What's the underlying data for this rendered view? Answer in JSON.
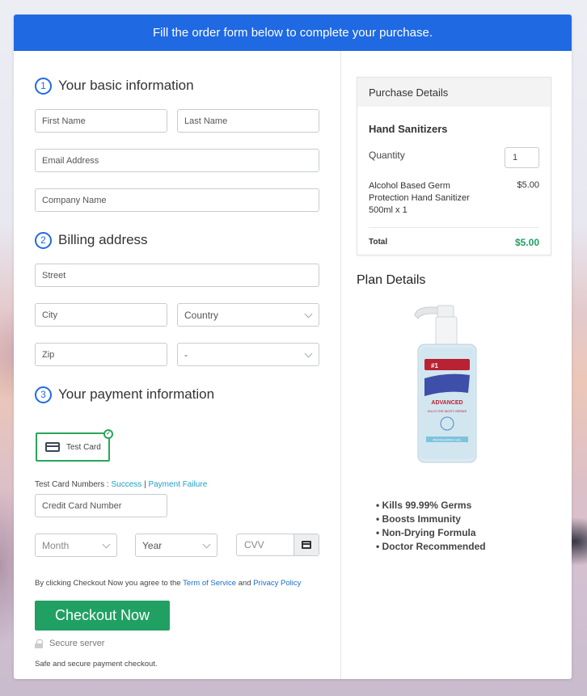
{
  "banner": {
    "text": "Fill the order form below to complete your purchase."
  },
  "sections": {
    "basic": {
      "step": "1",
      "title": "Your basic information"
    },
    "billing": {
      "step": "2",
      "title": "Billing address"
    },
    "payment": {
      "step": "3",
      "title": "Your payment information"
    }
  },
  "fields": {
    "first_name": {
      "placeholder": "First Name"
    },
    "last_name": {
      "placeholder": "Last Name"
    },
    "email": {
      "placeholder": "Email Address"
    },
    "company": {
      "placeholder": "Company Name"
    },
    "street": {
      "placeholder": "Street"
    },
    "city": {
      "placeholder": "City"
    },
    "country": {
      "value": "Country"
    },
    "zip": {
      "placeholder": "Zip"
    },
    "state": {
      "value": "-"
    },
    "card_number": {
      "placeholder": "Credit Card Number"
    },
    "month": {
      "value": "Month"
    },
    "year": {
      "value": "Year"
    },
    "cvv": {
      "placeholder": "CVV"
    }
  },
  "payment": {
    "method_label": "Test Card",
    "method_selected": true,
    "test_numbers_label": "Test Card Numbers :",
    "success_link": "Success",
    "separator": "|",
    "failure_link": "Payment Failure"
  },
  "agreement": {
    "prefix": "By clicking Checkout Now you agree to the",
    "tos_link": "Term of Service",
    "and": "and",
    "privacy_link": "Privacy Policy"
  },
  "checkout": {
    "button_label": "Checkout Now",
    "secure_label": "Secure server",
    "safe_text": "Safe and secure payment checkout."
  },
  "purchase": {
    "header": "Purchase Details",
    "product_title": "Hand Sanitizers",
    "quantity_label": "Quantity",
    "quantity_value": "1",
    "item_description": "Alcohol Based Germ Protection Hand Sanitizer 500ml x 1",
    "item_price": "$5.00",
    "total_label": "Total",
    "total_value": "$5.00"
  },
  "plan": {
    "title": "Plan Details",
    "features": [
      "Kills 99.99% Germs",
      "Boosts Immunity",
      "Non-Drying Formula",
      "Doctor Recommended"
    ],
    "image_alt": "hand-sanitizer-bottle",
    "label_top": "#1",
    "label_brand": "ADVANCED",
    "label_tag": "KILLS THE MOST GERMS",
    "label_gel": "REFRESHING GEL"
  },
  "colors": {
    "banner": "#1f69e3",
    "accent_green": "#21a063",
    "link_teal": "#1ea0c9",
    "link_blue": "#1a6fc9"
  }
}
